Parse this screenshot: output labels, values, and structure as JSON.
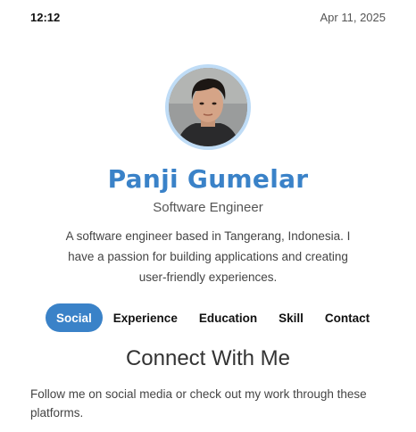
{
  "status_bar": {
    "time": "12:12",
    "date": "Apr 11, 2025"
  },
  "profile": {
    "name": "Panji Gumelar",
    "role": "Software Engineer",
    "bio": "A software engineer based in Tangerang, Indonesia. I have a passion for building applications and creating user-friendly experiences."
  },
  "tabs": [
    {
      "label": "Social",
      "active": true
    },
    {
      "label": "Experience",
      "active": false
    },
    {
      "label": "Education",
      "active": false
    },
    {
      "label": "Skill",
      "active": false
    },
    {
      "label": "Contact",
      "active": false
    }
  ],
  "section": {
    "title": "Connect With Me",
    "description": "Follow me on social media or check out my work through these platforms."
  },
  "colors": {
    "accent": "#3a82c8",
    "avatar_ring": "#bfdcf6"
  }
}
